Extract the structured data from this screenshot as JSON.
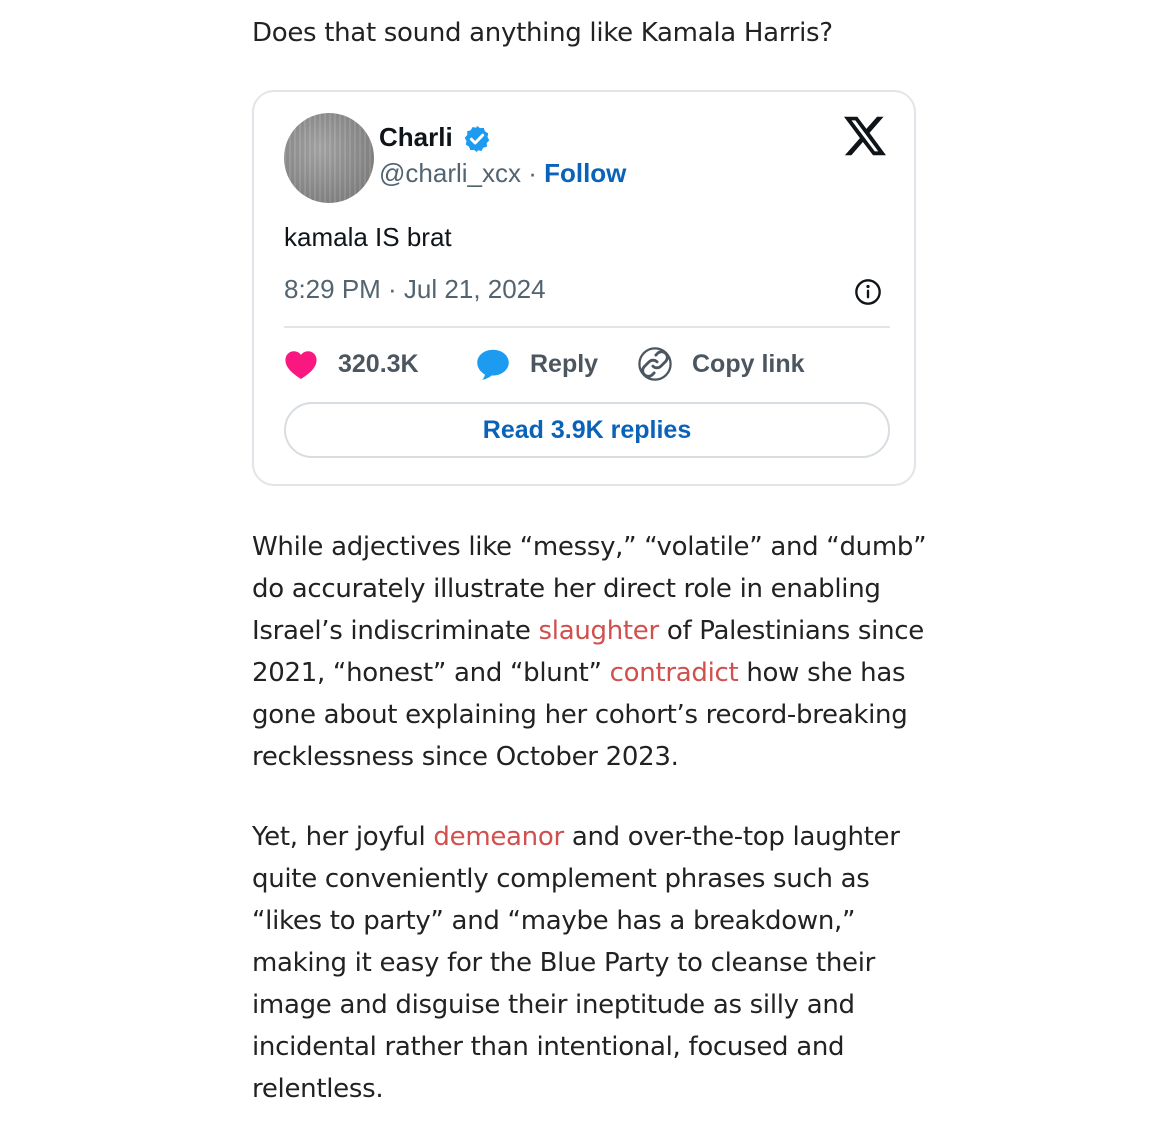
{
  "intro": "Does that sound anything like Kamala Harris?",
  "tweet": {
    "name": "Charli",
    "handle": "@charli_xcx",
    "separator": " · ",
    "follow": "Follow",
    "text": "kamala IS brat",
    "time": "8:29 PM · Jul 21, 2024",
    "likes": "320.3K",
    "reply": "Reply",
    "copy_link": "Copy link",
    "read_replies": "Read 3.9K replies",
    "colors": {
      "like": "#f91880",
      "reply": "#1d9bf0",
      "verified": "#1d9bf0",
      "link": "#0a63b9"
    },
    "icons": [
      "verified-badge-icon",
      "x-logo-icon",
      "info-icon",
      "heart-icon",
      "reply-bubble-icon",
      "link-icon"
    ]
  },
  "paragraph1": {
    "a": "While adjectives like “messy,” “volatile” and “dumb” do accurately illustrate her direct role in enabling Israel’s indiscriminate ",
    "link1": "slaughter",
    "b": " of Palestinians since 2021, “honest” and “blunt” ",
    "link2": "contradict",
    "c": " how she has gone about explaining her cohort’s record-breaking recklessness since October 2023."
  },
  "paragraph2": {
    "a": "Yet, her joyful ",
    "link1": "demeanor",
    "b": " and over-the-top laughter quite conveniently complement phrases such as “likes to party” and “maybe has a breakdown,” making it easy for the Blue Party to cleanse their image and disguise their ineptitude as silly and incidental rather than intentional, focused and relentless."
  },
  "link_color": "#d0504d"
}
